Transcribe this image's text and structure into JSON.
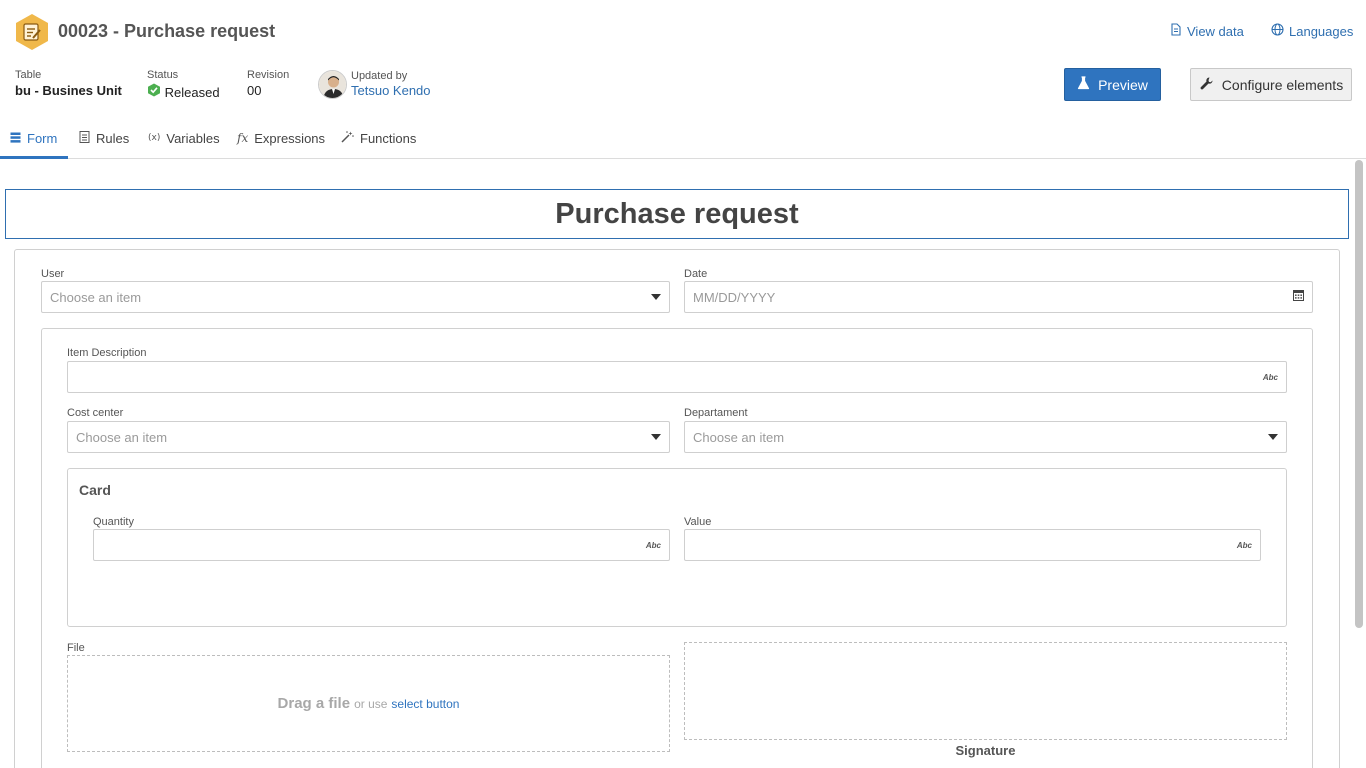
{
  "header": {
    "title": "00023 - Purchase request",
    "view_data": "View data",
    "languages": "Languages",
    "table_label": "Table",
    "table_value": "bu - Busines Unit",
    "status_label": "Status",
    "status_value": "Released",
    "revision_label": "Revision",
    "revision_value": "00",
    "updated_label": "Updated by",
    "updated_user": "Tetsuo Kendo",
    "preview_button": "Preview",
    "configure_button": "Configure elements"
  },
  "tabs": [
    {
      "label": "Form",
      "icon": "form-icon",
      "active": true
    },
    {
      "label": "Rules",
      "icon": "rules-icon",
      "active": false
    },
    {
      "label": "Variables",
      "icon": "variables-icon",
      "active": false
    },
    {
      "label": "Expressions",
      "icon": "fx-icon",
      "active": false
    },
    {
      "label": "Functions",
      "icon": "wand-icon",
      "active": false
    }
  ],
  "tab_icons": {
    "variables": "(x)",
    "expressions": "fx"
  },
  "form": {
    "title": "Purchase request",
    "user": {
      "label": "User",
      "placeholder": "Choose an item"
    },
    "date": {
      "label": "Date",
      "placeholder": "MM/DD/YYYY"
    },
    "item_description": {
      "label": "Item Description",
      "badge": "Abc"
    },
    "cost_center": {
      "label": "Cost center",
      "placeholder": "Choose an item"
    },
    "department": {
      "label": "Departament",
      "placeholder": "Choose an item"
    },
    "card": {
      "title": "Card",
      "quantity": {
        "label": "Quantity",
        "badge": "Abc"
      },
      "value": {
        "label": "Value",
        "badge": "Abc"
      }
    },
    "file": {
      "label": "File",
      "drag_text": "Drag a file",
      "or_use": "or use",
      "select_button": "select button"
    },
    "signature": {
      "label": "Signature"
    }
  },
  "colors": {
    "accent": "#2f74bf",
    "link": "#2f6fb0",
    "status_ok": "#4caf50",
    "header_icon": "#f0b84a"
  }
}
